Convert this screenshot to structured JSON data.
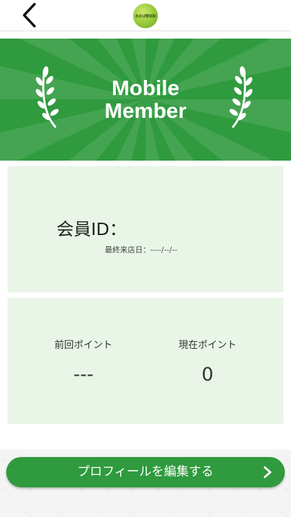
{
  "header": {
    "back_icon": "chevron-left-icon",
    "logo_text": "あおば整体院"
  },
  "banner": {
    "title_line1": "Mobile",
    "title_line2": "Member",
    "background_color": "#2f9a3e",
    "wreath_icon": "laurel-wreath-icon"
  },
  "member": {
    "id_label": "会員ID：",
    "last_visit_label": "最終来店日：",
    "last_visit_value": "----/--/--"
  },
  "points": {
    "previous_label": "前回ポイント",
    "previous_value": "---",
    "current_label": "現在ポイント",
    "current_value": "0"
  },
  "footer": {
    "edit_profile_label": "プロフィールを編集する",
    "chevron_icon": "chevron-right-icon",
    "button_color": "#2f9a3e"
  }
}
